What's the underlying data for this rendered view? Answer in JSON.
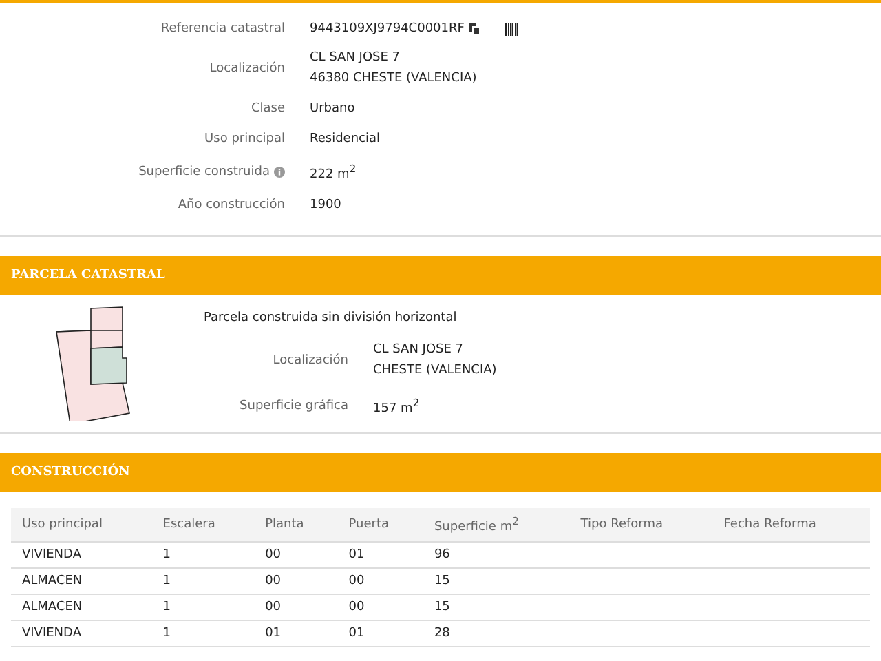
{
  "summary": {
    "rows": [
      {
        "kind": "ref",
        "label": "Referencia catastral",
        "lines": [
          "9443109XJ9794C0001RF"
        ]
      },
      {
        "kind": "text",
        "label": "Localización",
        "lines": [
          "CL SAN JOSE 7",
          "46380 CHESTE (VALENCIA)"
        ]
      },
      {
        "kind": "text",
        "label": "Clase",
        "lines": [
          "Urbano"
        ]
      },
      {
        "kind": "text",
        "label": "Uso principal",
        "lines": [
          "Residencial"
        ]
      },
      {
        "kind": "info",
        "label": "Superficie construida",
        "lines": [
          "222 m$^{2}$"
        ]
      },
      {
        "kind": "text",
        "label": "Año construcción",
        "lines": [
          "1900"
        ]
      }
    ]
  },
  "parcela": {
    "title": "PARCELA CATASTRAL",
    "description": "Parcela construida sin división horizontal",
    "rows": [
      {
        "label": "Localización",
        "lines": [
          "CL SAN JOSE 7",
          "CHESTE (VALENCIA)"
        ]
      },
      {
        "label": "Superficie gráfica",
        "lines": [
          "157 m$^{2}$"
        ]
      }
    ]
  },
  "construccion": {
    "title": "CONSTRUCCIÓN",
    "columns": [
      "Uso principal",
      "Escalera",
      "Planta",
      "Puerta",
      "Superficie m$^{2}$",
      "Tipo Reforma",
      "Fecha Reforma"
    ],
    "rows": [
      [
        "VIVIENDA",
        "1",
        "00",
        "01",
        "96"
      ],
      [
        "ALMACEN",
        "1",
        "00",
        "00",
        "15"
      ],
      [
        "ALMACEN",
        "1",
        "00",
        "00",
        "15"
      ],
      [
        "VIVIENDA",
        "1",
        "01",
        "01",
        "28"
      ]
    ]
  }
}
